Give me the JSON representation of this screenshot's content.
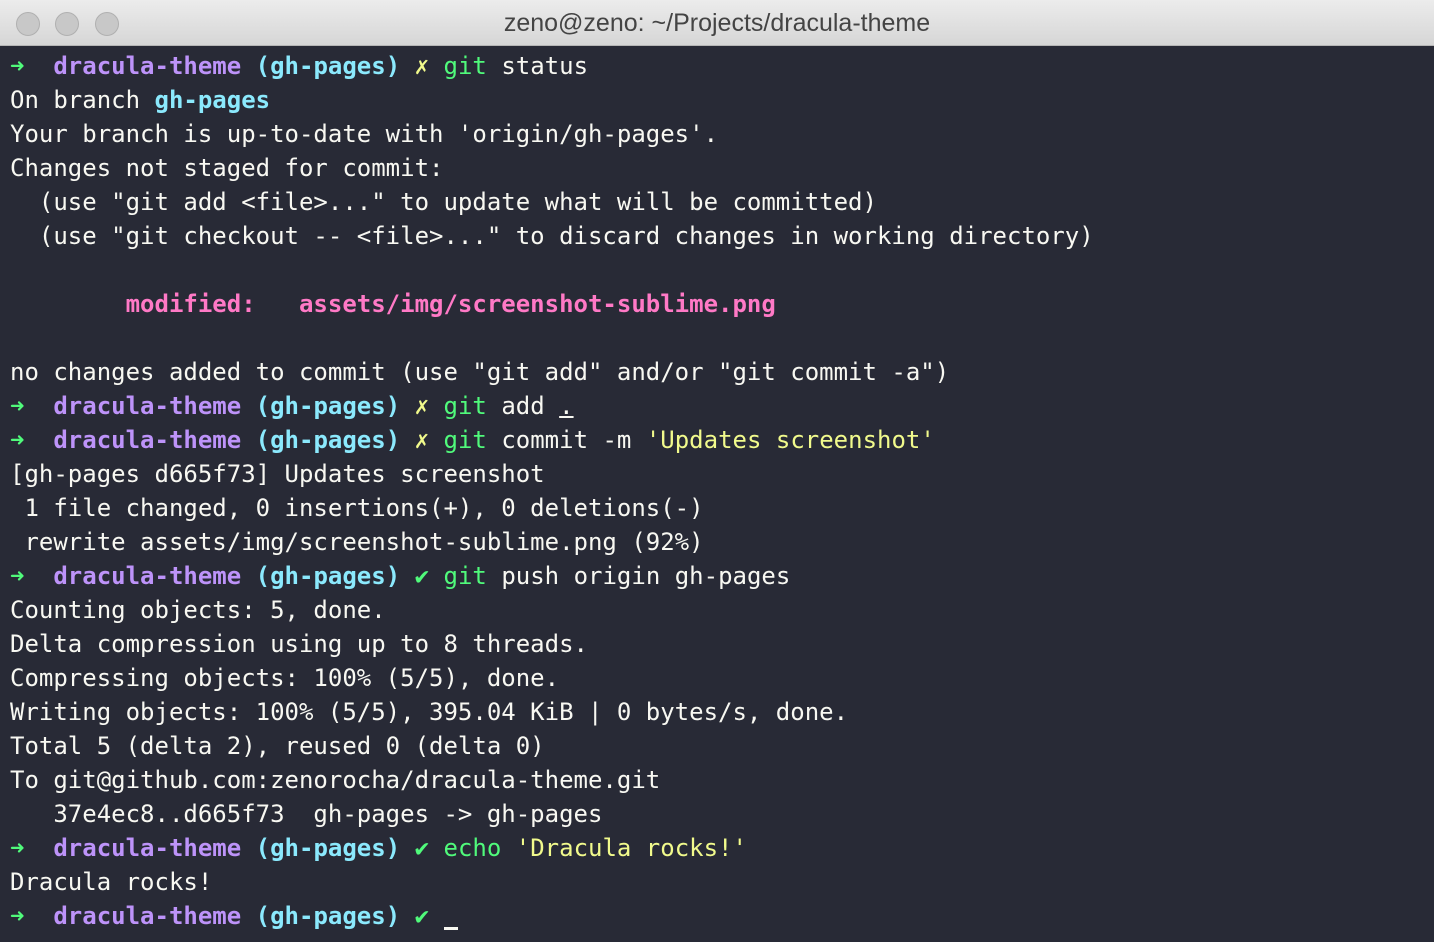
{
  "window": {
    "title": "zeno@zeno: ~/Projects/dracula-theme"
  },
  "prompt": {
    "arrow": "➜",
    "dir": "dracula-theme",
    "branch": "(gh-pages)",
    "dirty_mark": "✗",
    "clean_mark": "✔"
  },
  "colors": {
    "background": "#282a36",
    "foreground": "#f8f8f2",
    "green": "#50fa7b",
    "purple": "#bd93f9",
    "cyan": "#8be9fd",
    "yellow": "#f1fa8c",
    "pink": "#ff79c6"
  },
  "terminal": {
    "cmd1_name": "git",
    "cmd1_args": " status",
    "out_on_branch": "On branch ",
    "out_on_branch_name": "gh-pages",
    "out_uptodate": "Your branch is up-to-date with 'origin/gh-pages'.",
    "out_changes": "Changes not staged for commit:",
    "out_hint1": "  (use \"git add <file>...\" to update what will be committed)",
    "out_hint2": "  (use \"git checkout -- <file>...\" to discard changes in working directory)",
    "out_modified_label": "        modified:   ",
    "out_modified_file": "assets/img/screenshot-sublime.png",
    "out_no_changes": "no changes added to commit (use \"git add\" and/or \"git commit -a\")",
    "cmd2_name": "git",
    "cmd2_args": " add ",
    "cmd2_dot": ".",
    "cmd3_name": "git",
    "cmd3_args": " commit -m ",
    "cmd3_msg": "'Updates screenshot'",
    "out_commit1": "[gh-pages d665f73] Updates screenshot",
    "out_commit2": " 1 file changed, 0 insertions(+), 0 deletions(-)",
    "out_commit3": " rewrite assets/img/screenshot-sublime.png (92%)",
    "cmd4_name": "git",
    "cmd4_args": " push origin gh-pages",
    "out_push1": "Counting objects: 5, done.",
    "out_push2": "Delta compression using up to 8 threads.",
    "out_push3": "Compressing objects: 100% (5/5), done.",
    "out_push4": "Writing objects: 100% (5/5), 395.04 KiB | 0 bytes/s, done.",
    "out_push5": "Total 5 (delta 2), reused 0 (delta 0)",
    "out_push6": "To git@github.com:zenorocha/dracula-theme.git",
    "out_push7": "   37e4ec8..d665f73  gh-pages -> gh-pages",
    "cmd5_name": "echo",
    "cmd5_str": "'Dracula rocks!'",
    "out_echo": "Dracula rocks!"
  }
}
